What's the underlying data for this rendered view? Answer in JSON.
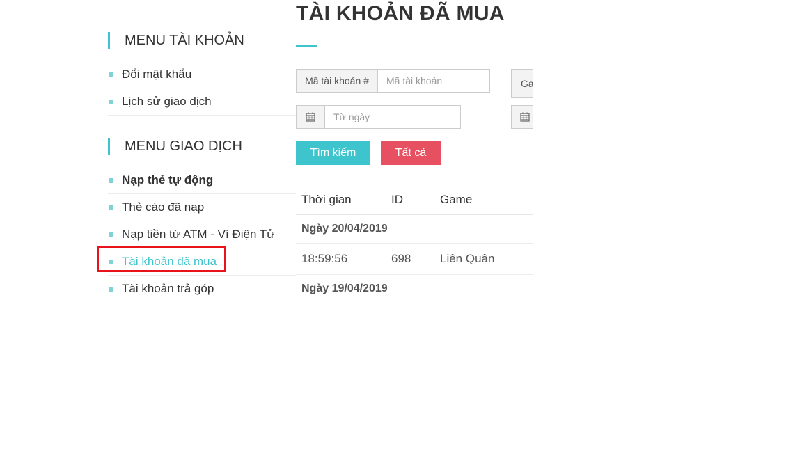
{
  "sidebar": {
    "account_menu": {
      "heading": "MENU TÀI KHOẢN",
      "items": [
        {
          "label": "Đổi mật khẩu"
        },
        {
          "label": "Lịch sử giao dịch"
        }
      ]
    },
    "transaction_menu": {
      "heading": "MENU GIAO DỊCH",
      "items": [
        {
          "label": "Nạp thẻ tự động"
        },
        {
          "label": "Thẻ cào đã nạp"
        },
        {
          "label": "Nạp tiền từ ATM - Ví Điện Tử"
        },
        {
          "label": "Tài khoản đã mua"
        },
        {
          "label": "Tài khoản trả góp"
        }
      ]
    }
  },
  "main": {
    "title": "TÀI KHOẢN ĐÃ MUA",
    "filters": {
      "account_code_label": "Mã tài khoản #",
      "account_code_placeholder": "Mã tài khoản",
      "game_addon_partial": "Ga",
      "from_date_placeholder": "Từ ngày"
    },
    "buttons": {
      "search": "Tìm kiếm",
      "all": "Tất cả"
    },
    "table": {
      "headers": [
        "Thời gian",
        "ID",
        "Game"
      ],
      "groups": [
        {
          "date": "Ngày 20/04/2019",
          "rows": [
            {
              "time": "18:59:56",
              "id": "698",
              "game": "Liên Quân"
            }
          ]
        },
        {
          "date": "Ngày 19/04/2019",
          "rows": []
        }
      ]
    }
  },
  "colors": {
    "accent": "#3ec4cd",
    "danger": "#e75060",
    "highlight_border": "#e8131b"
  }
}
